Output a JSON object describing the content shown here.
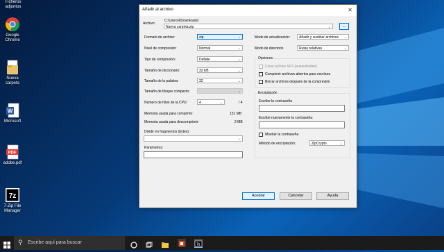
{
  "desktop": {
    "top_label": "Ficheros adjuntos",
    "icons": [
      {
        "name": "chrome",
        "label": "Google Chrome"
      },
      {
        "name": "folder",
        "label": "Nueva carpeta"
      },
      {
        "name": "word",
        "label": "Microsoft"
      },
      {
        "name": "pdf",
        "label": "adobe.pdf"
      },
      {
        "name": "7zip",
        "label": "7-Zip File Manager"
      }
    ]
  },
  "dialog": {
    "title": "Añadir al archivo",
    "archive_label": "Archivo:",
    "archive_path": "C:\\Users\\l\\Downloads\\",
    "archive_name": "Nueva carpeta.zip",
    "browse_label": "...",
    "left": {
      "format_label": "Formato de archivo:",
      "format_value": "zip",
      "level_label": "Nivel de compresión:",
      "level_value": "Normal",
      "type_label": "Tipo de compresión:",
      "type_value": "Deflate",
      "dict_label": "Tamaño de diccionario:",
      "dict_value": "32 KB",
      "word_label": "Tamaño de la palabra:",
      "word_value": "32",
      "block_label": "Tamaño de bloque compacto:",
      "block_value": "",
      "threads_label": "Número de hilos de la CPU:",
      "threads_value": "4",
      "threads_max": "/ 4",
      "mem_comp_label": "Memoria usada para comprimir:",
      "mem_comp_value": "131 MB",
      "mem_decomp_label": "Memoria usada para descomprimir:",
      "mem_decomp_value": "2 MB",
      "split_label": "Dividir en fragmentos (bytes):",
      "split_value": "",
      "params_label": "Parámetros:",
      "params_value": ""
    },
    "right": {
      "update_label": "Modo de actualización:",
      "update_value": "Añadir y sustituir archivos",
      "path_label": "Modo de directorio",
      "path_value": "Rutas relativas",
      "options_title": "Opciones",
      "opt_sfx": "Crear archivo SFX (autoextraíble)",
      "opt_shared": "Comprimir archivos abiertos para escritura",
      "opt_delete": "Borrar archivos después de la compresión",
      "enc_title": "Encriptación",
      "pwd_label": "Escribe la contraseña",
      "pwd2_label": "Escribe nuevamente la contraseña:",
      "show_pwd": "Mostrar la contraseña",
      "enc_method_label": "Método de encriptación:",
      "enc_method_value": "ZipCrypto"
    },
    "buttons": {
      "ok": "Aceptar",
      "cancel": "Cancelar",
      "help": "Ayuda"
    }
  },
  "taskbar": {
    "search_placeholder": "Escribe aquí para buscar"
  }
}
